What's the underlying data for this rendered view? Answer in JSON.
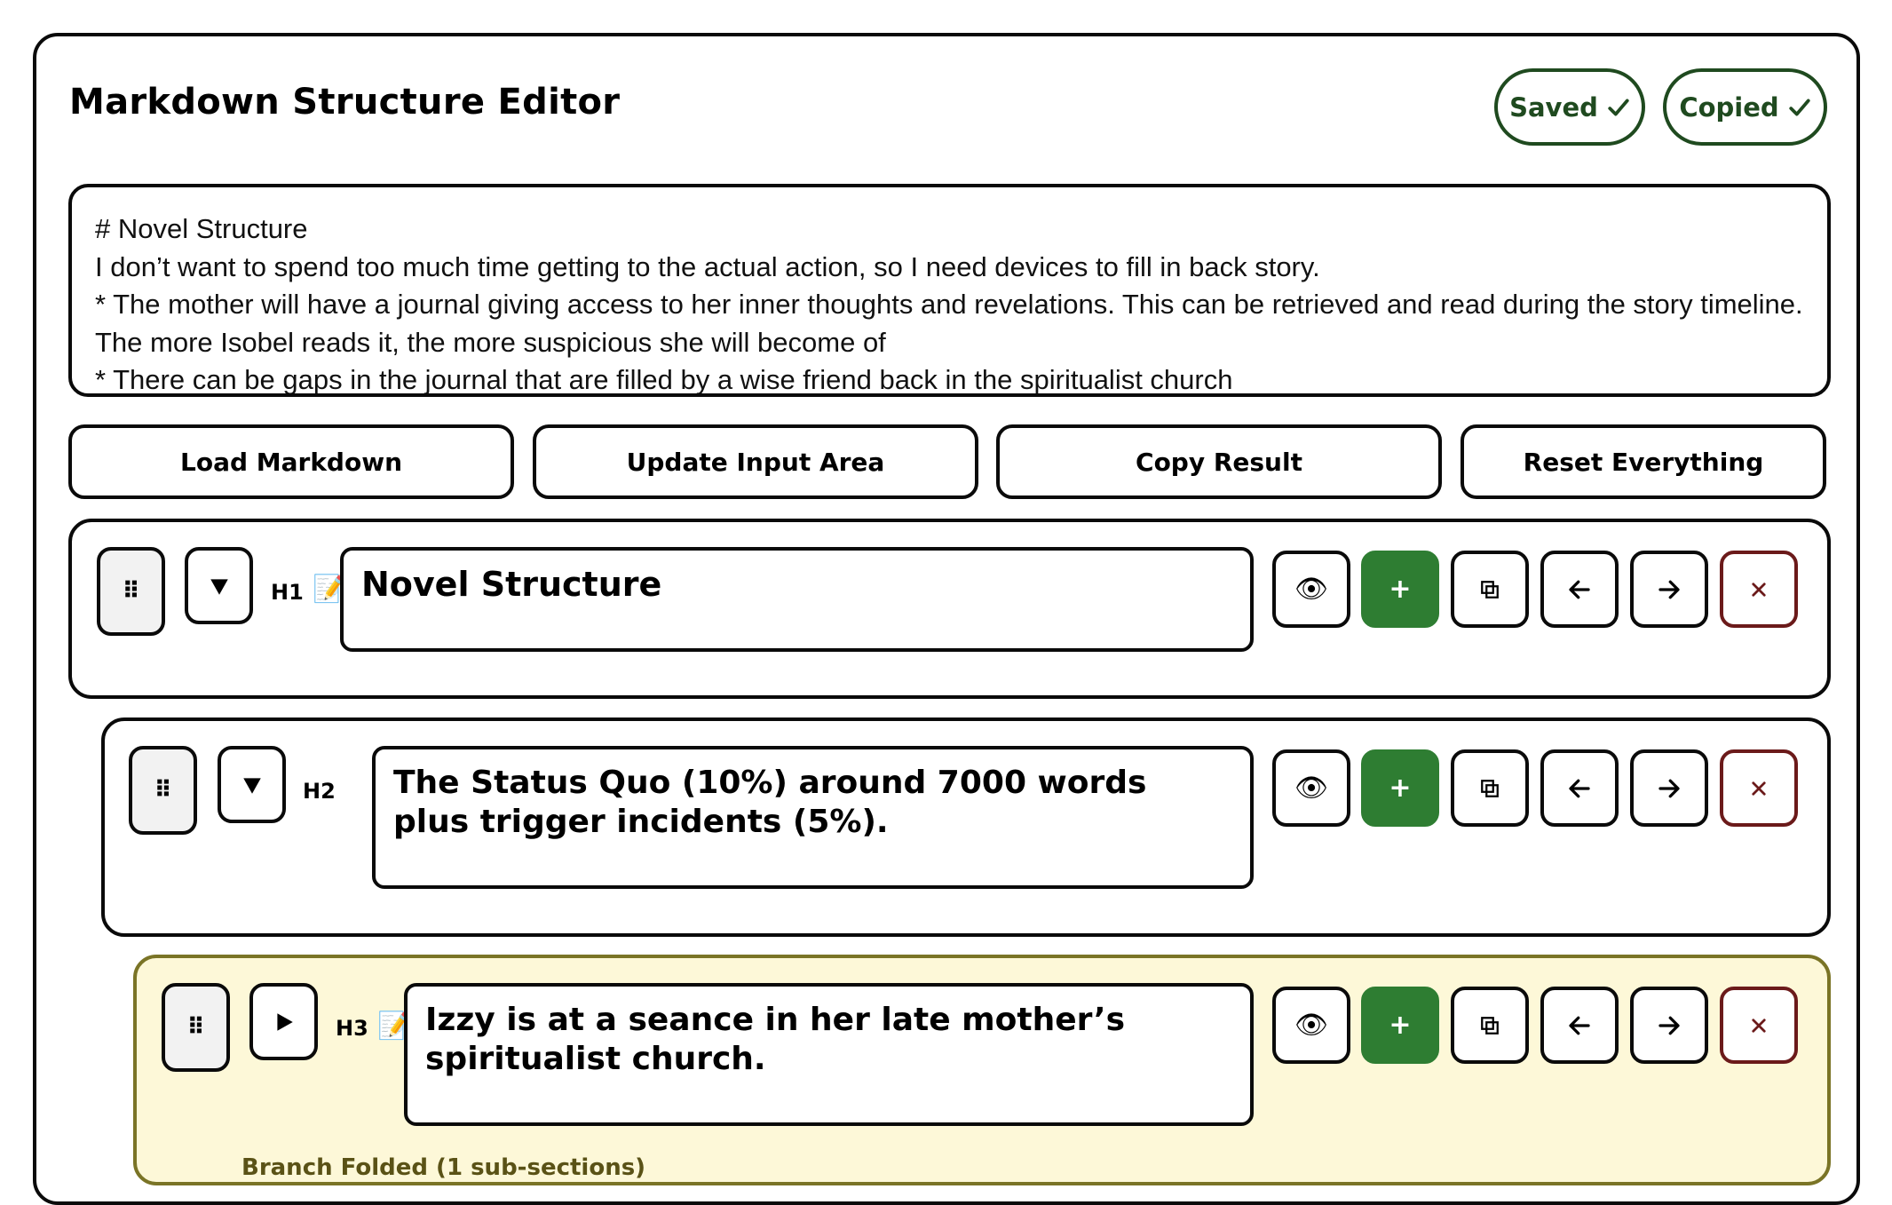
{
  "app": {
    "title": "Markdown Structure Editor"
  },
  "status": {
    "saved": "Saved",
    "copied": "Copied"
  },
  "input": {
    "lines": [
      "# Novel Structure",
      "I don’t want to spend too much time getting to the actual action, so I need devices to fill in back story.",
      "* The mother will have a journal giving access to her inner thoughts and revelations. This can be retrieved and read during the story timeline. The more Isobel reads it, the more suspicious she will become of",
      "* There can be gaps in the journal that are filled by a wise friend back in the spiritualist church"
    ]
  },
  "toolbar": {
    "load": "Load Markdown",
    "update": "Update Input Area",
    "copy": "Copy Result",
    "reset": "Reset Everything"
  },
  "sections": [
    {
      "level": "H1",
      "heading": "Novel Structure",
      "expanded": true,
      "has_note_icon": true
    },
    {
      "level": "H2",
      "heading": "The Status Quo (10%) around 7000 words plus trigger incidents (5%).",
      "expanded": true,
      "has_note_icon": false
    },
    {
      "level": "H3",
      "heading": "Izzy is at a seance in her late mother’s spiritualist church.",
      "expanded": false,
      "has_note_icon": true,
      "folded_text": "Branch Folded (1 sub-sections)"
    }
  ],
  "icons": {
    "drag": "⠿",
    "preview": "👁",
    "add": "+",
    "note": "📝"
  },
  "colors": {
    "accent_green": "#2e7d32",
    "pill_green": "#1f4a1f",
    "delete_red": "#6b1a1a",
    "folded_bg": "#fdf8d8"
  }
}
